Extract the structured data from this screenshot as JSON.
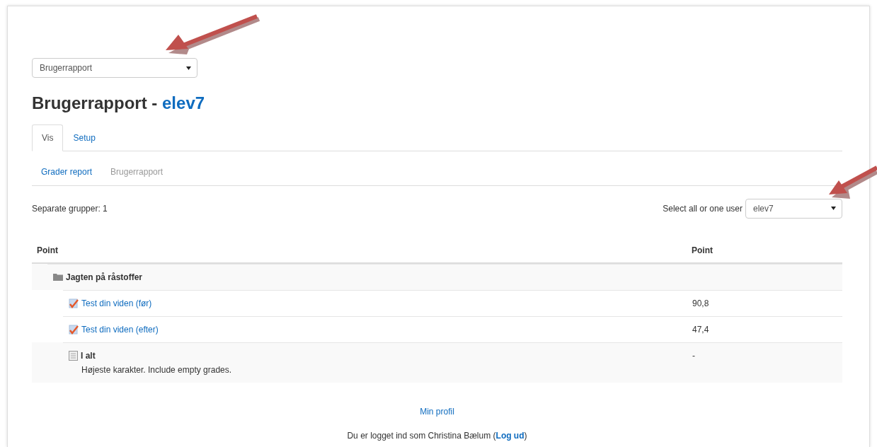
{
  "report_select": {
    "value": "Brugerrapport"
  },
  "heading": {
    "title": "Brugerrapport - ",
    "user": "elev7"
  },
  "tabs": [
    {
      "label": "Vis",
      "selected": true
    },
    {
      "label": "Setup",
      "selected": false
    }
  ],
  "subtabs": [
    {
      "label": "Grader report",
      "selected": false
    },
    {
      "label": "Brugerrapport",
      "selected": true
    }
  ],
  "group_info": "Separate grupper: 1",
  "user_select": {
    "label": "Select all or one user",
    "value": "elev7"
  },
  "table": {
    "columns": [
      "Point",
      "Point"
    ],
    "rows": [
      {
        "kind": "category",
        "name": "Jagten på råstoffer",
        "value": ""
      },
      {
        "kind": "item",
        "name": "Test din viden (før)",
        "value": "90,8"
      },
      {
        "kind": "item",
        "name": "Test din viden (efter)",
        "value": "47,4"
      },
      {
        "kind": "total",
        "name": "I alt",
        "note": "Højeste karakter. Include empty grades.",
        "value": "-"
      }
    ]
  },
  "footer": {
    "profile_link": "Min profil",
    "login_text": "Du er logget ind som Christina Bælum (",
    "logout_link": "Log ud",
    "login_text_end": ")"
  }
}
